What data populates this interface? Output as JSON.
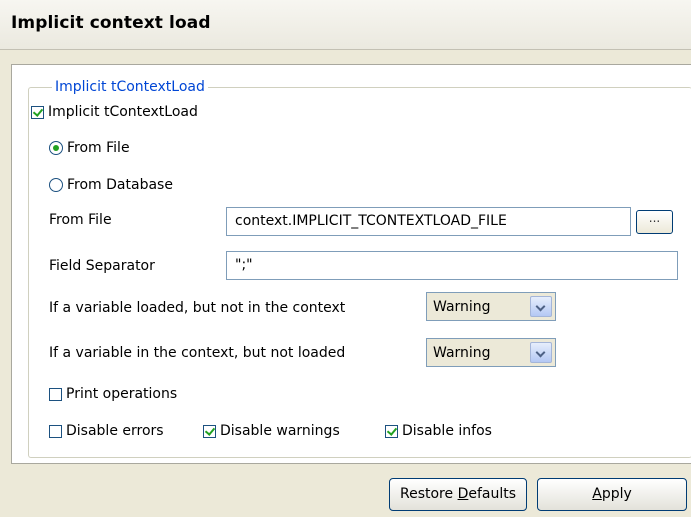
{
  "header": {
    "title": "Implicit context load"
  },
  "group": {
    "legend": "Implicit tContextLoad",
    "implicit_checkbox": {
      "label": "Implicit tContextLoad",
      "checked": true
    },
    "source_options": [
      {
        "label": "From File",
        "selected": true
      },
      {
        "label": "From Database",
        "selected": false
      }
    ],
    "from_file": {
      "label": "From File",
      "value": "context.IMPLICIT_TCONTEXTLOAD_FILE",
      "browse_label": "..."
    },
    "field_separator": {
      "label": "Field Separator",
      "value": "\";\""
    },
    "loaded_not_in_context": {
      "label": "If a variable loaded, but not in the context",
      "value": "Warning"
    },
    "in_context_not_loaded": {
      "label": "If a variable in the context, but not loaded",
      "value": "Warning"
    },
    "print_operations": {
      "label": "Print operations",
      "checked": false
    },
    "disable_errors": {
      "label": "Disable errors",
      "checked": false
    },
    "disable_warnings": {
      "label": "Disable warnings",
      "checked": true
    },
    "disable_infos": {
      "label": "Disable infos",
      "checked": true
    }
  },
  "footer": {
    "restore_defaults": {
      "prefix": "Restore ",
      "mnemonic": "D",
      "suffix": "efaults"
    },
    "apply": {
      "mnemonic": "A",
      "suffix": "pply"
    }
  },
  "colors": {
    "legend": "#0046d5",
    "check": "#21a121",
    "background": "#ece9d8"
  }
}
